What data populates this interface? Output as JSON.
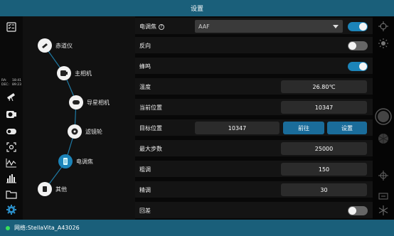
{
  "title": "设置",
  "sidebar": {
    "ra_label": "RA:",
    "ra_value": "18:41",
    "dec_label": "DEC:",
    "dec_value": "89:23",
    "icons": [
      "checklist-icon",
      "telescope-icon",
      "camera-icon",
      "guide-camera-icon",
      "target-icon",
      "graph-icon",
      "histogram-icon",
      "folder-icon",
      "gear-icon"
    ]
  },
  "tree": {
    "nodes": [
      {
        "label": "赤道仪",
        "icon": "mount-icon",
        "selected": false
      },
      {
        "label": "主相机",
        "icon": "main-camera-icon",
        "selected": false
      },
      {
        "label": "导星相机",
        "icon": "guide-camera-icon",
        "selected": false
      },
      {
        "label": "滤镜轮",
        "icon": "filter-wheel-icon",
        "selected": false
      },
      {
        "label": "电调焦",
        "icon": "focuser-icon",
        "selected": true
      },
      {
        "label": "其他",
        "icon": "other-icon",
        "selected": false
      }
    ]
  },
  "settings": {
    "focuser": {
      "label": "电调焦",
      "help": "?",
      "selected": "AAF",
      "enabled": true
    },
    "reverse": {
      "label": "反向",
      "enabled": false
    },
    "beep": {
      "label": "蜂鸣",
      "enabled": true
    },
    "temperature": {
      "label": "温度",
      "value": "26.80℃"
    },
    "current_position": {
      "label": "当前位置",
      "value": "10347"
    },
    "target_position": {
      "label": "目标位置",
      "value": "10347",
      "go_label": "前往",
      "set_label": "设置"
    },
    "max_steps": {
      "label": "最大步数",
      "value": "25000"
    },
    "coarse": {
      "label": "粗调",
      "value": "150"
    },
    "fine": {
      "label": "精调",
      "value": "30"
    },
    "backlash": {
      "label": "回差",
      "enabled": false
    }
  },
  "rightbar": {
    "icons": [
      "crosshair-icon",
      "sun-icon",
      "shutter-button-icon",
      "aperture-icon",
      "target-cross-icon",
      "box-icon",
      "snowflake-icon"
    ]
  },
  "status": {
    "label": "网络: ",
    "network": "StellaVita_A43026",
    "color": "#37e05a"
  },
  "colors": {
    "accent": "#1c84b9",
    "header": "#1a5f7a"
  }
}
